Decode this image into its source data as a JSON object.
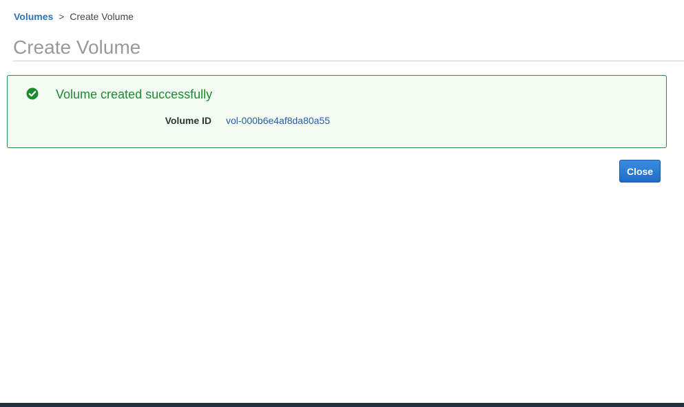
{
  "breadcrumb": {
    "parent": "Volumes",
    "separator": ">",
    "current": "Create Volume"
  },
  "page": {
    "title": "Create Volume"
  },
  "alert": {
    "icon": "check-circle-icon",
    "message": "Volume created successfully",
    "fields": [
      {
        "label": "Volume ID",
        "value": "vol-000b6e4af8da80a55"
      }
    ]
  },
  "actions": {
    "close_label": "Close"
  },
  "colors": {
    "link": "#2a74b8",
    "success": "#1d8a2e",
    "success_bg": "#f3fcf3",
    "primary_button": "#1f6cc8",
    "footer": "#232f3e"
  }
}
